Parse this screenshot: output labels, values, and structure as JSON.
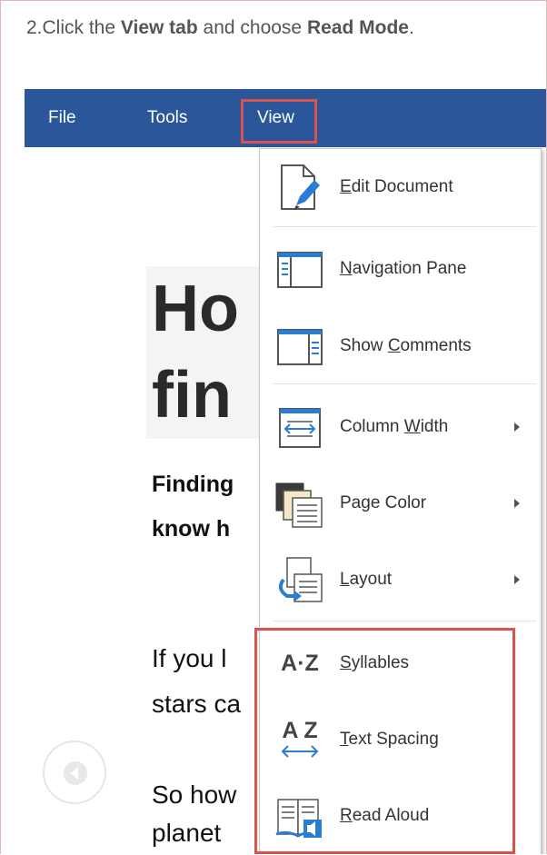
{
  "instruction": {
    "prefix": "2.Click the ",
    "bold1": "View tab",
    "middle": " and choose ",
    "bold2": "Read Mode",
    "suffix": "."
  },
  "menubar": {
    "file": "File",
    "tools": "Tools",
    "view": "View",
    "background": "#2b579a"
  },
  "document": {
    "title_line1": "Ho",
    "title_line2": "fin",
    "subtitle_line1": "Finding",
    "subtitle_line2": "know h",
    "para1_line1": "If you l",
    "para1_line2": "stars ca",
    "para2_line1": "So how",
    "para2_line2": "planet"
  },
  "view_menu": {
    "items": [
      {
        "icon": "edit-document-icon",
        "pre": "",
        "key": "E",
        "post": "dit Document"
      },
      {
        "icon": "navigation-pane-icon",
        "pre": "",
        "key": "N",
        "post": "avigation Pane"
      },
      {
        "icon": "show-comments-icon",
        "pre": "Show ",
        "key": "C",
        "post": "omments"
      },
      {
        "icon": "column-width-icon",
        "pre": "Column ",
        "key": "W",
        "post": "idth"
      },
      {
        "icon": "page-color-icon",
        "pre": "Pa",
        "key": "g",
        "post": "e Color"
      },
      {
        "icon": "layout-icon",
        "pre": "",
        "key": "L",
        "post": "ayout"
      },
      {
        "icon": "syllables-icon",
        "pre": "",
        "key": "S",
        "post": "yllables"
      },
      {
        "icon": "text-spacing-icon",
        "pre": "",
        "key": "T",
        "post": "ext Spacing"
      },
      {
        "icon": "read-aloud-icon",
        "pre": "",
        "key": "R",
        "post": "ead Aloud"
      }
    ],
    "syllables_glyph": "A·Z",
    "text_spacing_glyph": "A Z",
    "highlight_color": "#d9534f"
  }
}
